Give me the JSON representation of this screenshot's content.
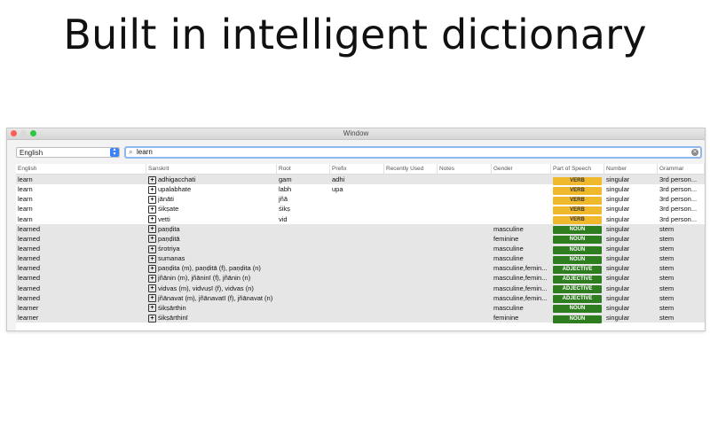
{
  "headline": "Built in intelligent dictionary",
  "window": {
    "title": "Window"
  },
  "colors": {
    "verb": "#f0b92b",
    "noun": "#2e7d1e",
    "adjective": "#2e7d1e",
    "search_focus": "#8eb7ee"
  },
  "toolbar": {
    "language": "English",
    "search_value": "learn",
    "search_icon": "magnifier-icon",
    "clear_icon": "clear-circle-icon"
  },
  "table": {
    "columns": [
      "English",
      "Sanskrit",
      "Root",
      "Prefix",
      "Recently Used",
      "Notes",
      "Gender",
      "Part of Speech",
      "Number",
      "Grammar"
    ],
    "rows": [
      {
        "english": "learn",
        "sanskrit": "adhigacchati",
        "root": "gam",
        "prefix": "adhi",
        "recent": "",
        "notes": "",
        "gender": "",
        "pos": "VERB",
        "pos_kind": "verb",
        "number": "singular",
        "grammar": "3rd person..."
      },
      {
        "english": "learn",
        "sanskrit": "upalabhate",
        "root": "labh",
        "prefix": "upa",
        "recent": "",
        "notes": "",
        "gender": "",
        "pos": "VERB",
        "pos_kind": "verb",
        "number": "singular",
        "grammar": "3rd person..."
      },
      {
        "english": "learn",
        "sanskrit": "jānāti",
        "root": "jñā",
        "prefix": "",
        "recent": "",
        "notes": "",
        "gender": "",
        "pos": "VERB",
        "pos_kind": "verb",
        "number": "singular",
        "grammar": "3rd person..."
      },
      {
        "english": "learn",
        "sanskrit": "śikṣate",
        "root": "śikṣ",
        "prefix": "",
        "recent": "",
        "notes": "",
        "gender": "",
        "pos": "VERB",
        "pos_kind": "verb",
        "number": "singular",
        "grammar": "3rd person..."
      },
      {
        "english": "learn",
        "sanskrit": "vetti",
        "root": "vid",
        "prefix": "",
        "recent": "",
        "notes": "",
        "gender": "",
        "pos": "VERB",
        "pos_kind": "verb",
        "number": "singular",
        "grammar": "3rd person..."
      },
      {
        "english": "learned",
        "sanskrit": "paṇḍita",
        "root": "",
        "prefix": "",
        "recent": "",
        "notes": "",
        "gender": "masculine",
        "pos": "NOUN",
        "pos_kind": "noun",
        "number": "singular",
        "grammar": "stem"
      },
      {
        "english": "learned",
        "sanskrit": "paṇḍitā",
        "root": "",
        "prefix": "",
        "recent": "",
        "notes": "",
        "gender": "feminine",
        "pos": "NOUN",
        "pos_kind": "noun",
        "number": "singular",
        "grammar": "stem"
      },
      {
        "english": "learned",
        "sanskrit": "śrotriya",
        "root": "",
        "prefix": "",
        "recent": "",
        "notes": "",
        "gender": "masculine",
        "pos": "NOUN",
        "pos_kind": "noun",
        "number": "singular",
        "grammar": "stem"
      },
      {
        "english": "learned",
        "sanskrit": "sumanas",
        "root": "",
        "prefix": "",
        "recent": "",
        "notes": "",
        "gender": "masculine",
        "pos": "NOUN",
        "pos_kind": "noun",
        "number": "singular",
        "grammar": "stem"
      },
      {
        "english": "learned",
        "sanskrit": "paṇḍita (m), paṇḍitā (f), paṇḍita (n)",
        "root": "",
        "prefix": "",
        "recent": "",
        "notes": "",
        "gender": "masculine,femin...",
        "pos": "ADJECTIVE",
        "pos_kind": "adjective",
        "number": "singular",
        "grammar": "stem"
      },
      {
        "english": "learned",
        "sanskrit": "jñānin (m), jñāninī (f), jñānin (n)",
        "root": "",
        "prefix": "",
        "recent": "",
        "notes": "",
        "gender": "masculine,femin...",
        "pos": "ADJECTIVE",
        "pos_kind": "adjective",
        "number": "singular",
        "grammar": "stem"
      },
      {
        "english": "learned",
        "sanskrit": "vidvas (m), vidvuṣī (f), vidvas (n)",
        "root": "",
        "prefix": "",
        "recent": "",
        "notes": "",
        "gender": "masculine,femin...",
        "pos": "ADJECTIVE",
        "pos_kind": "adjective",
        "number": "singular",
        "grammar": "stem"
      },
      {
        "english": "learned",
        "sanskrit": "jñānavat (m), jñānavatī (f), jñānavat (n)",
        "root": "",
        "prefix": "",
        "recent": "",
        "notes": "",
        "gender": "masculine,femin...",
        "pos": "ADJECTIVE",
        "pos_kind": "adjective",
        "number": "singular",
        "grammar": "stem"
      },
      {
        "english": "learner",
        "sanskrit": "śikṣārthin",
        "root": "",
        "prefix": "",
        "recent": "",
        "notes": "",
        "gender": "masculine",
        "pos": "NOUN",
        "pos_kind": "noun",
        "number": "singular",
        "grammar": "stem"
      },
      {
        "english": "learner",
        "sanskrit": "śikṣārthinī",
        "root": "",
        "prefix": "",
        "recent": "",
        "notes": "",
        "gender": "feminine",
        "pos": "NOUN",
        "pos_kind": "noun",
        "number": "singular",
        "grammar": "stem"
      }
    ]
  }
}
